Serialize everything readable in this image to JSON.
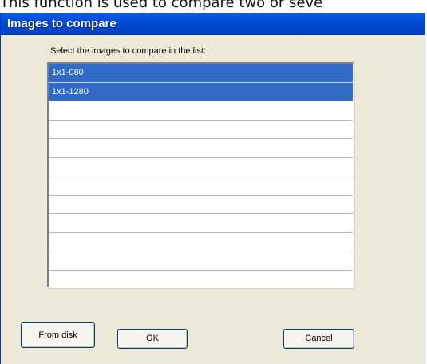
{
  "page": {
    "caption_above": "This function is used to compare two or seve"
  },
  "dialog": {
    "title": "Images to compare",
    "prompt": "Select the images to compare in the list:",
    "list": {
      "items": [
        {
          "label": "1x1-080",
          "selected": true
        },
        {
          "label": "1x1-1280",
          "selected": true
        },
        {
          "label": "",
          "selected": false
        },
        {
          "label": "",
          "selected": false
        },
        {
          "label": "",
          "selected": false
        },
        {
          "label": "",
          "selected": false
        },
        {
          "label": "",
          "selected": false
        },
        {
          "label": "",
          "selected": false
        },
        {
          "label": "",
          "selected": false
        },
        {
          "label": "",
          "selected": false
        },
        {
          "label": "",
          "selected": false
        },
        {
          "label": "",
          "selected": false
        }
      ]
    },
    "buttons": {
      "from_disk": "From disk",
      "ok": "OK",
      "cancel": "Cancel"
    }
  },
  "colors": {
    "title_bar": "#0049d1",
    "dialog_face": "#ece9d8",
    "selection": "#316ac5"
  }
}
